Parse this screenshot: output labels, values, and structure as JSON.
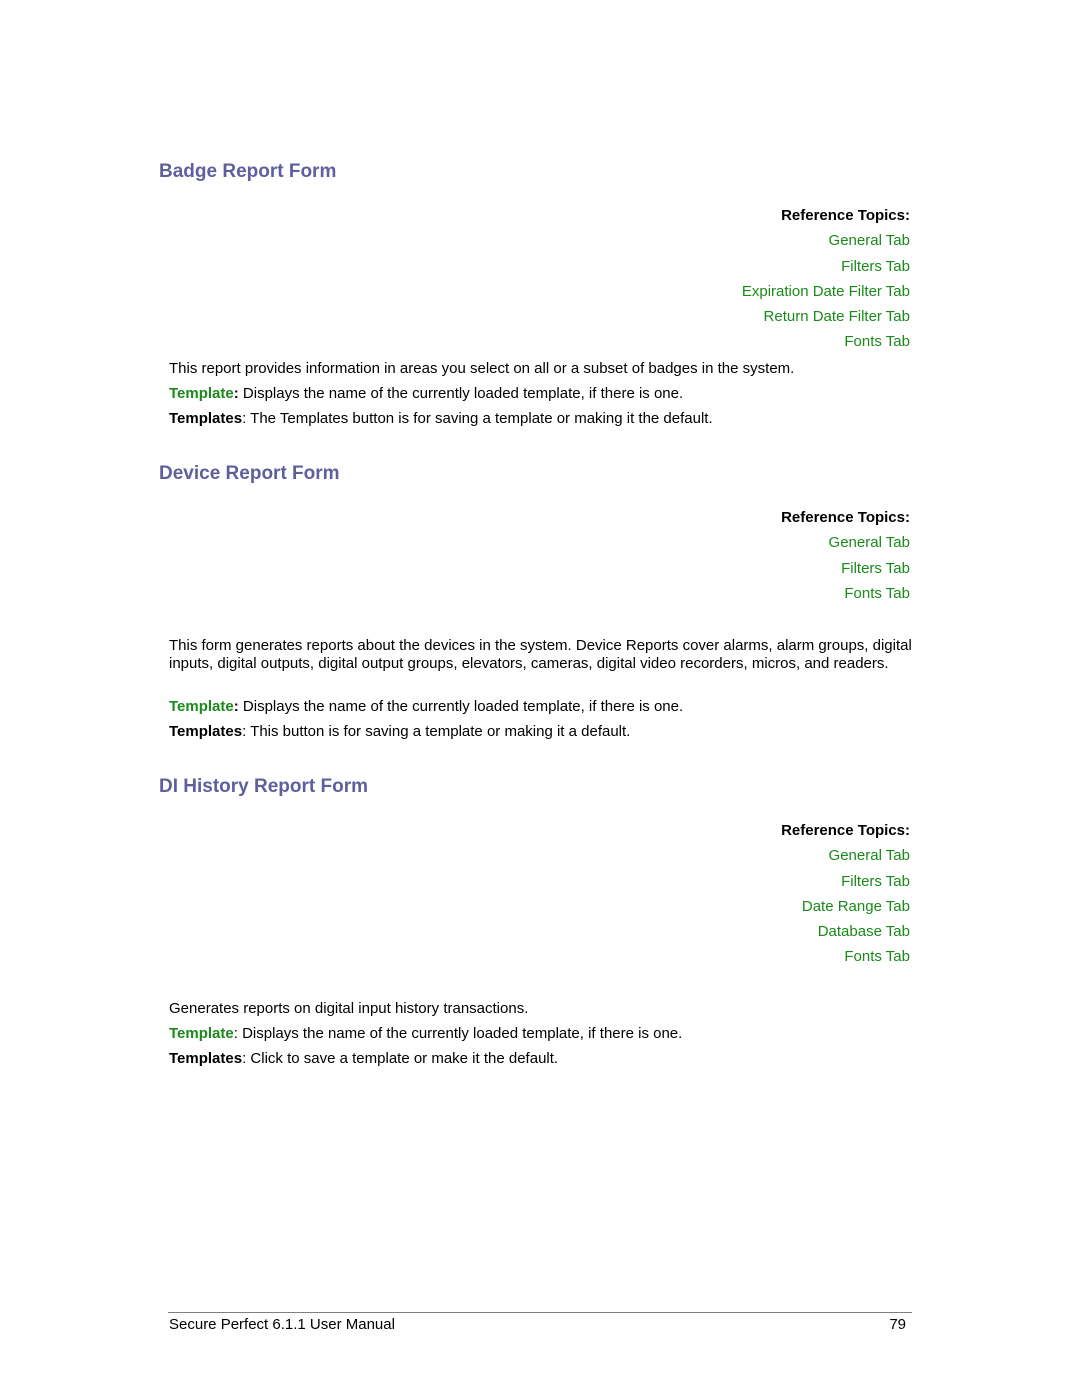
{
  "sections": [
    {
      "title": "Badge Report Form",
      "reference_heading": "Reference Topics:",
      "reference_links": [
        "General Tab",
        "Filters Tab",
        "Expiration Date Filter Tab",
        "Return Date Filter Tab",
        "Fonts Tab"
      ],
      "description": "This report provides information in areas you select on all or a subset of badges in the system.",
      "template_label": "Template",
      "template_colon": ":",
      "template_text": " Displays the name of the currently loaded template, if there is one.",
      "templates_label": "Templates",
      "templates_text": ": The Templates button is for saving a template or making it the default."
    },
    {
      "title": "Device Report Form",
      "reference_heading": "Reference Topics:",
      "reference_links": [
        "General Tab",
        "Filters Tab",
        "Fonts Tab"
      ],
      "description": "This form generates reports about the devices in the system. Device Reports cover alarms, alarm groups, digital inputs, digital outputs, digital output groups, elevators, cameras, digital video recorders, micros, and readers.",
      "template_label": "Template",
      "template_colon": ":",
      "template_text": " Displays the name of the currently loaded template, if there is one.",
      "templates_label": "Templates",
      "templates_text": ": This button is for saving a template or making it a default."
    },
    {
      "title": "DI History Report Form",
      "reference_heading": "Reference Topics:",
      "reference_links": [
        "General Tab",
        "Filters Tab",
        "Date Range Tab",
        "Database Tab",
        "Fonts Tab"
      ],
      "description": "Generates reports on digital input history transactions.",
      "template_label": "Template",
      "template_text": ": Displays the name of the currently loaded template, if there is one.",
      "templates_label": "Templates",
      "templates_text": ": Click to save a template or make it the default."
    }
  ],
  "footer": {
    "manual_title": "Secure Perfect 6.1.1 User Manual",
    "page_number": "79"
  },
  "colors": {
    "heading": "#5f5f9e",
    "link": "#1a8a1a",
    "text": "#000000"
  }
}
